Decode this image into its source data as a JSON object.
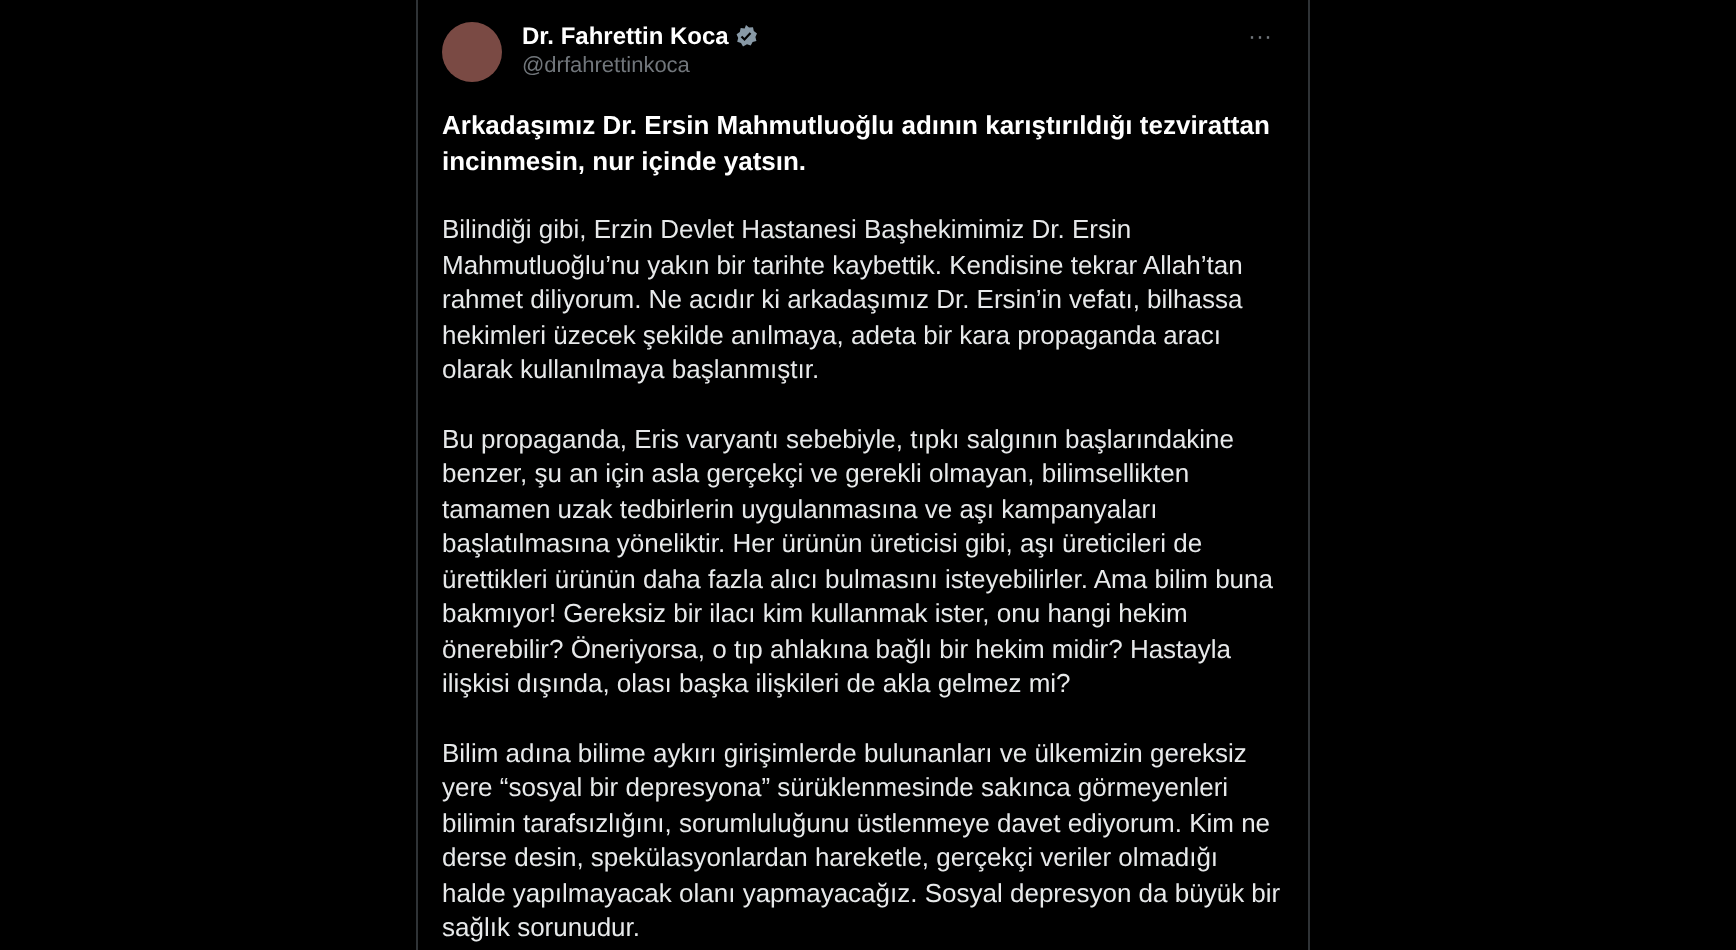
{
  "post": {
    "author": {
      "name": "Dr. Fahrettin Koca",
      "handle": "@drfahrettinkoca",
      "verified": true
    },
    "more_button": "···",
    "paragraphs": [
      {
        "kind": "bold",
        "text": "Arkadaşımız Dr. Ersin Mahmutluoğlu adının karıştırıldığı tezvirattan incinmesin, nur içinde yatsın."
      },
      {
        "kind": "plain",
        "text": "Bilindiği gibi, Erzin Devlet Hastanesi Başhekimimiz Dr. Ersin Mahmutluoğlu’nu yakın bir tarihte kaybettik. Kendisine tekrar Allah’tan rahmet diliyorum. Ne acıdır ki arkadaşımız Dr. Ersin’in vefatı, bilhassa hekimleri üzecek şekilde anılmaya, adeta bir kara propaganda aracı olarak kullanılmaya başlanmıştır."
      },
      {
        "kind": "plain",
        "text": "Bu propaganda, Eris varyantı sebebiyle, tıpkı salgının başlarındakine benzer, şu an için asla gerçekçi ve gerekli olmayan, bilimsellikten tamamen uzak tedbirlerin uygulanmasına ve aşı kampanyaları başlatılmasına yöneliktir. Her ürünün üreticisi gibi, aşı üreticileri de ürettikleri ürünün daha fazla alıcı bulmasını isteyebilirler. Ama bilim buna bakmıyor! Gereksiz bir ilacı kim kullanmak ister, onu hangi hekim önerebilir? Öneriyorsa, o tıp ahlakına bağlı bir hekim midir? Hastayla ilişkisi dışında, olası başka ilişkileri de akla gelmez mi?"
      },
      {
        "kind": "plain",
        "text": "Bilim adına bilime aykırı girişimlerde bulunanları ve ülkemizin gereksiz yere “sosyal bir depresyona” sürüklenmesinde sakınca görmeyenleri bilimin tarafsızlığını, sorumluluğunu üstlenmeye davet ediyorum. Kim ne derse desin, spekülasyonlardan hareketle, gerçekçi veriler olmadığı halde yapılmayacak olanı yapmayacağız. Sosyal depresyon da büyük bir sağlık sorunudur."
      }
    ]
  }
}
